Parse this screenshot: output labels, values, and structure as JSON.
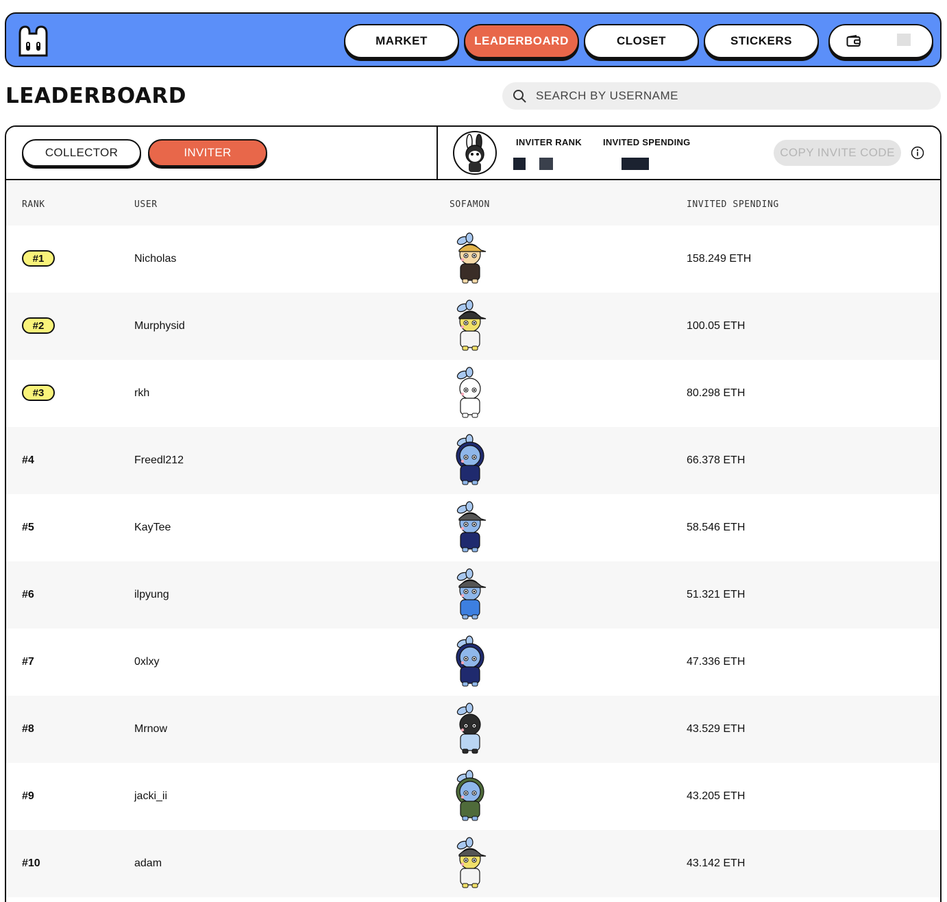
{
  "nav": {
    "items": [
      {
        "label": "MARKET"
      },
      {
        "label": "LEADERBOARD"
      },
      {
        "label": "CLOSET"
      },
      {
        "label": "STICKERS"
      }
    ],
    "wallet_icon": "wallet-icon",
    "accent": "#5b8ff9",
    "active_color": "#e8674a"
  },
  "page": {
    "title": "LEADERBOARD"
  },
  "search": {
    "placeholder": "SEARCH BY USERNAME",
    "icon": "search-icon"
  },
  "panel": {
    "tabs": [
      {
        "label": "COLLECTOR"
      },
      {
        "label": "INVITER"
      }
    ],
    "inviter_rank_label": "INVITER RANK",
    "invited_spending_label": "INVITED SPENDING",
    "copy_button": "COPY INVITE CODE",
    "info_icon": "info-icon"
  },
  "table": {
    "headers": {
      "rank": "RANK",
      "user": "USER",
      "sofamon": "SOFAMON",
      "spending": "INVITED SPENDING"
    },
    "rows": [
      {
        "rank": "#1",
        "user": "Nicholas",
        "spending": "158.249 ETH",
        "outfit": "brown",
        "hat": "#e2b34a",
        "face": "#f5d9a8"
      },
      {
        "rank": "#2",
        "user": "Murphysid",
        "spending": "100.05 ETH",
        "outfit": "white",
        "hat": "#333333",
        "face": "#f1e06a"
      },
      {
        "rank": "#3",
        "user": "rkh",
        "spending": "80.298 ETH",
        "outfit": "plain",
        "hat": "none",
        "face": "#ffffff"
      },
      {
        "rank": "#4",
        "user": "Freedl212",
        "spending": "66.378 ETH",
        "outfit": "navy",
        "hat": "hood",
        "face": "#8fb7ea"
      },
      {
        "rank": "#5",
        "user": "KayTee",
        "spending": "58.546 ETH",
        "outfit": "navy",
        "hat": "#555555",
        "face": "#8fb7ea"
      },
      {
        "rank": "#6",
        "user": "ilpyung",
        "spending": "51.321 ETH",
        "outfit": "blue",
        "hat": "#555555",
        "face": "#8fb7ea"
      },
      {
        "rank": "#7",
        "user": "0xlxy",
        "spending": "47.336 ETH",
        "outfit": "navy",
        "hat": "hood",
        "face": "#8fb7ea"
      },
      {
        "rank": "#8",
        "user": "Mrnow",
        "spending": "43.529 ETH",
        "outfit": "lightblue",
        "hat": "none",
        "face": "#2b2b2b"
      },
      {
        "rank": "#9",
        "user": "jacki_ii",
        "spending": "43.205 ETH",
        "outfit": "camo",
        "hat": "hood",
        "face": "#8fb7ea"
      },
      {
        "rank": "#10",
        "user": "adam",
        "spending": "43.142 ETH",
        "outfit": "white",
        "hat": "#555555",
        "face": "#f1e06a"
      }
    ]
  }
}
